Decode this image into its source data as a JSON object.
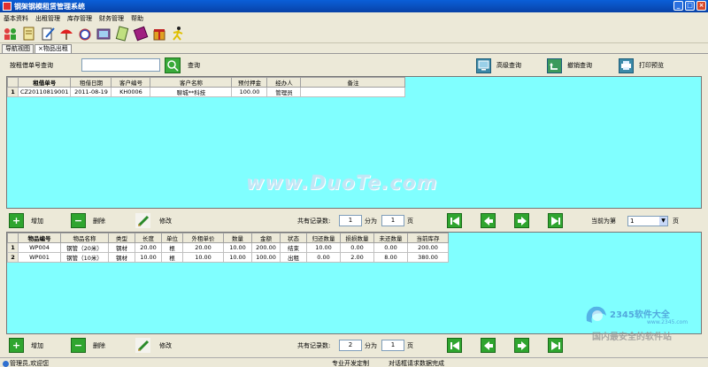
{
  "window": {
    "title": "钢架钢模租赁管理系统"
  },
  "menu": [
    "基本资料",
    "出租管理",
    "库存管理",
    "财务管理",
    "帮助"
  ],
  "toolbar_icons": [
    "people-icon",
    "document-icon",
    "edit-icon",
    "umbrella-icon",
    "alarm-clock-icon",
    "picture-icon",
    "notepad-icon",
    "book-icon",
    "gift-icon",
    "running-man-icon"
  ],
  "tabs": [
    {
      "label": "导航视图"
    },
    {
      "label": "×物品出租"
    }
  ],
  "search": {
    "label": "按租借单号查询",
    "value": "",
    "button_label": "查询",
    "advanced_label": "高级查询",
    "cancel_label": "撤销查询",
    "print_label": "打印预览"
  },
  "order_grid": {
    "columns": [
      "租借单号",
      "租借日期",
      "客户编号",
      "客户名称",
      "预付押金",
      "经办人",
      "备注"
    ],
    "rows": [
      {
        "num": "1",
        "cells": [
          "CZ20110819001",
          "2011-08-19",
          "KH0006",
          "聊城**科技",
          "100.00",
          "管理员",
          ""
        ]
      }
    ]
  },
  "watermark": "www.DuoTe.com",
  "action_bar_1": {
    "add_label": "增加",
    "delete_label": "删除",
    "edit_label": "修改",
    "total_label": "共有记录数:",
    "total_value": "1",
    "split_label": "分为",
    "pages_value": "1",
    "page_unit": "页",
    "current_label": "当前为第",
    "current_value": "1",
    "current_unit": "页"
  },
  "item_grid": {
    "columns": [
      "物品编号",
      "物品名称",
      "类型",
      "长度",
      "单位",
      "外租单价",
      "数量",
      "金额",
      "状态",
      "归还数量",
      "损损数量",
      "未还数量",
      "当前库存"
    ],
    "rows": [
      {
        "num": "1",
        "cells": [
          "WP004",
          "钢管（20米）",
          "钢材",
          "20.00",
          "根",
          "20.00",
          "10.00",
          "200.00",
          "结束",
          "10.00",
          "0.00",
          "0.00",
          "200.00"
        ]
      },
      {
        "num": "2",
        "cells": [
          "WP001",
          "钢管（10米）",
          "钢材",
          "10.00",
          "根",
          "10.00",
          "10.00",
          "100.00",
          "出租",
          "0.00",
          "2.00",
          "8.00",
          "380.00"
        ]
      }
    ]
  },
  "action_bar_2": {
    "add_label": "增加",
    "delete_label": "删除",
    "edit_label": "修改",
    "total_label": "共有记录数:",
    "total_value": "2",
    "split_label": "分为",
    "pages_value": "1",
    "page_unit": "页"
  },
  "statusbar": {
    "user": "管理员,欢迎您",
    "dev": "专业开发定制",
    "status": "对话框请求数据完成"
  },
  "brand_watermark": {
    "top_text": "2345软件大全",
    "url": "www.2345.com",
    "bottom_text": "国内最安全的软件站"
  }
}
